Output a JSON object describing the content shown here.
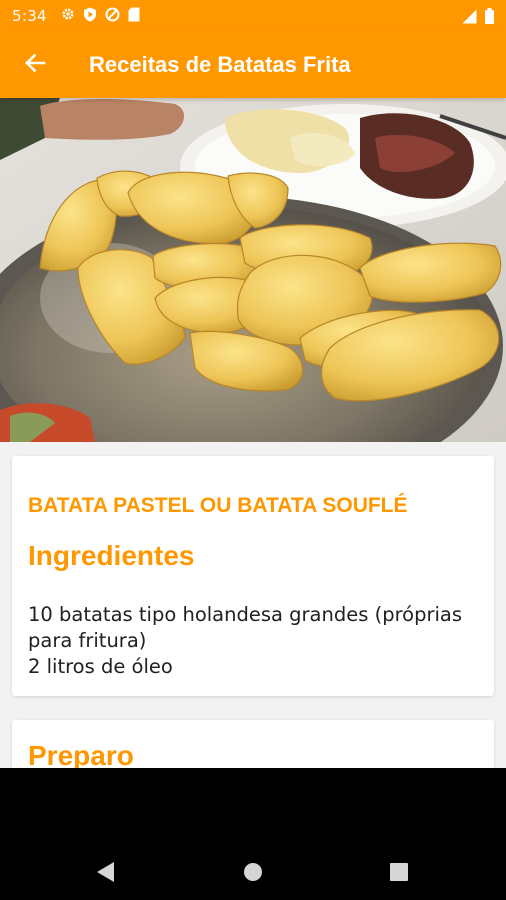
{
  "status_bar": {
    "time": "5:34",
    "left_icons": [
      "gear-icon",
      "play-protect-icon",
      "do-not-disturb-icon",
      "sd-card-icon"
    ],
    "right_icons": [
      "signal-icon",
      "battery-icon"
    ]
  },
  "app_bar": {
    "title": "Receitas de Batatas Frita",
    "back_icon": "arrow-back-icon",
    "background_color": "#ff9800"
  },
  "hero_image": {
    "description_icon": "recipe-photo"
  },
  "recipe": {
    "title": "BATATA PASTEL OU BATATA SOUFLÉ",
    "ingredients_heading": "Ingredientes",
    "ingredients_lines": [
      "10 batatas tipo holandesa grandes (próprias",
      "para fritura)",
      "2 litros de óleo"
    ],
    "preparo_heading": "Preparo"
  },
  "nav_bar": {
    "buttons": [
      "back-triangle-icon",
      "home-circle-icon",
      "recents-square-icon"
    ]
  },
  "colors": {
    "accent": "#ff9800",
    "text": "#212121",
    "background": "#f2f2f2"
  }
}
